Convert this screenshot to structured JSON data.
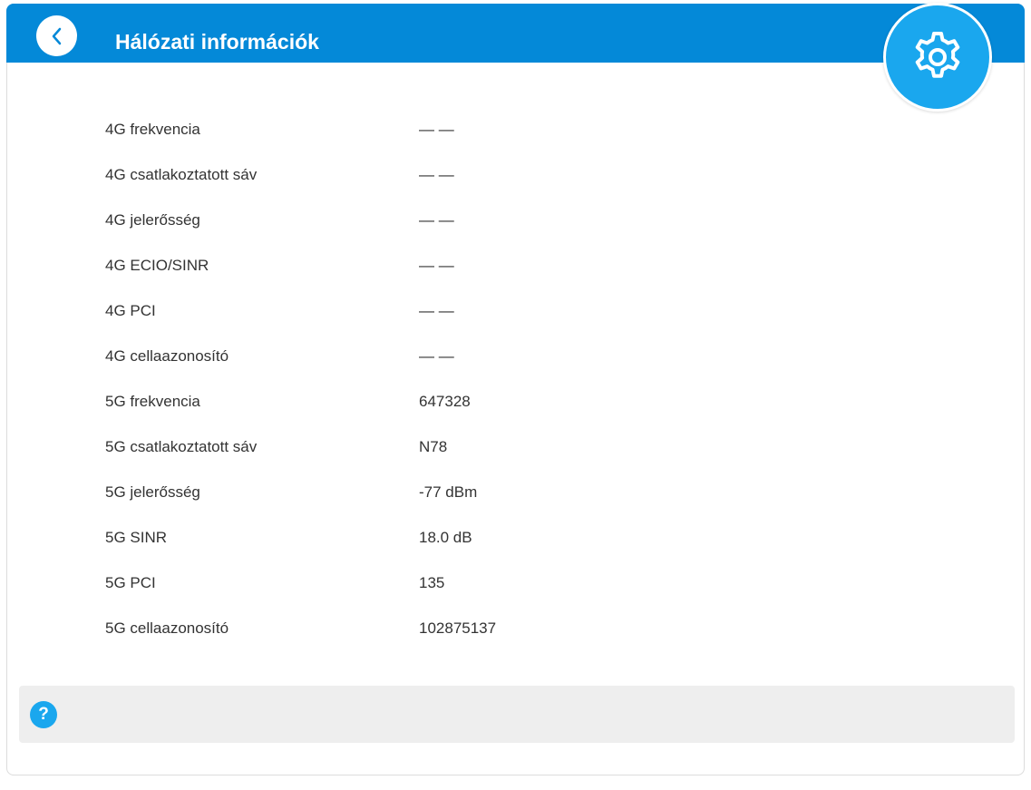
{
  "header": {
    "title": "Hálózati információk",
    "back_icon": "chevron-left-icon",
    "settings_icon": "gear-icon"
  },
  "network_info": {
    "rows": [
      {
        "label": "4G frekvencia",
        "value": "— —"
      },
      {
        "label": "4G csatlakoztatott sáv",
        "value": "— —"
      },
      {
        "label": "4G jelerősség",
        "value": "— —"
      },
      {
        "label": "4G ECIO/SINR",
        "value": "— —"
      },
      {
        "label": "4G PCI",
        "value": "— —"
      },
      {
        "label": "4G cellaazonosító",
        "value": "— —"
      },
      {
        "label": "5G frekvencia",
        "value": "647328"
      },
      {
        "label": "5G csatlakoztatott sáv",
        "value": "N78"
      },
      {
        "label": "5G jelerősség",
        "value": "-77 dBm"
      },
      {
        "label": "5G SINR",
        "value": "18.0 dB"
      },
      {
        "label": "5G PCI",
        "value": "135"
      },
      {
        "label": "5G cellaazonosító",
        "value": "102875137"
      }
    ]
  },
  "help": {
    "icon": "help-icon",
    "icon_glyph": "?"
  },
  "colors": {
    "header_blue": "#0489d8",
    "accent_blue": "#1aa7ee",
    "help_bar_bg": "#eeeeee",
    "text": "#333333"
  }
}
